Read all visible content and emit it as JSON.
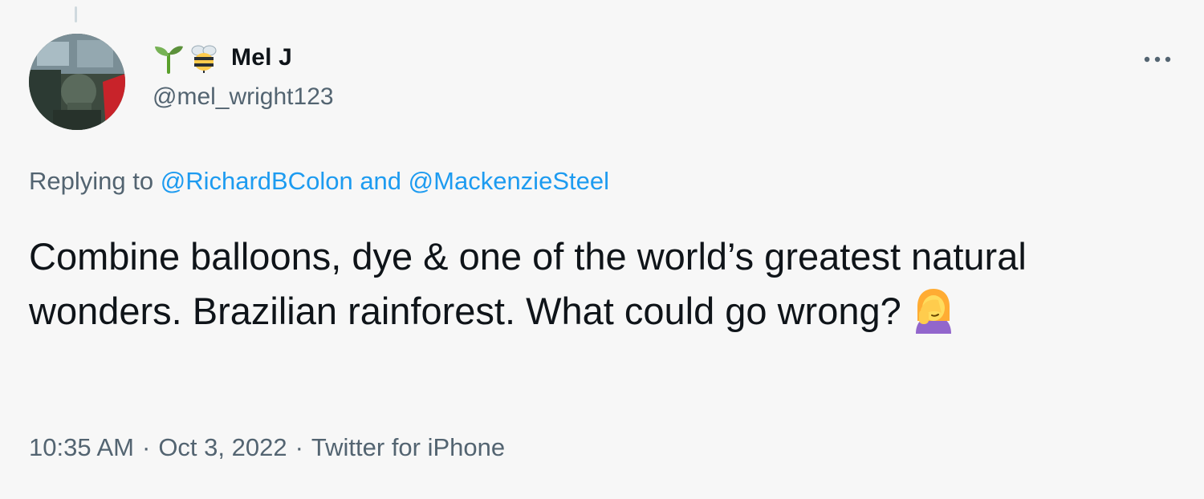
{
  "author": {
    "name_emojis": [
      "seedling-icon",
      "bee-icon"
    ],
    "display_name": "Mel J",
    "handle": "@mel_wright123",
    "avatar": "avatar-photo"
  },
  "actions": {
    "more_icon": "more-horizontal-icon"
  },
  "reply": {
    "prefix": "Replying to",
    "mention_1": "@RichardBColon",
    "conjunction": "and",
    "mention_2": "@MackenzieSteel"
  },
  "tweet": {
    "text": "Combine balloons, dye & one of the world’s greatest natural wonders. Brazilian rainforest. What could go wrong?",
    "trailing_emoji": "facepalm-icon"
  },
  "meta": {
    "time": "10:35 AM",
    "separator": "·",
    "date": "Oct 3, 2022",
    "source": "Twitter for iPhone"
  },
  "colors": {
    "background": "#f7f7f7",
    "text": "#0f1419",
    "secondary": "#536471",
    "link": "#1d9bf0"
  }
}
